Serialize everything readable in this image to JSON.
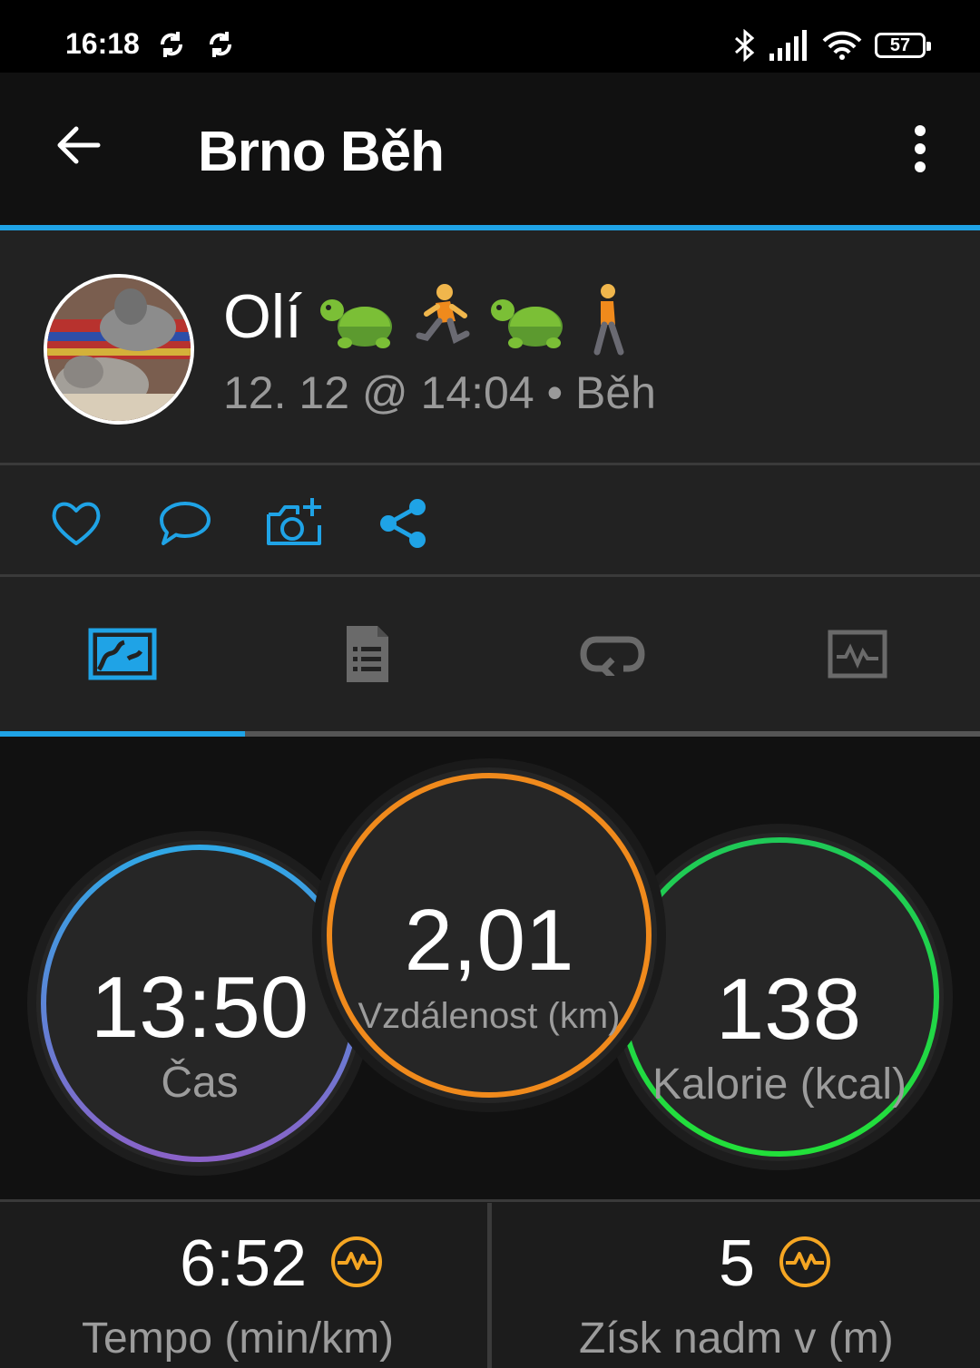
{
  "status_bar": {
    "time": "16:18",
    "battery": "57"
  },
  "header": {
    "title": "Brno Běh"
  },
  "profile": {
    "name": "Olí",
    "emoji_status": "🐢🏃🐢🚶",
    "meta": "12. 12 @ 14:04 • Běh"
  },
  "tabs": [
    {
      "icon": "map-icon",
      "active": true
    },
    {
      "icon": "document-list-icon",
      "active": false
    },
    {
      "icon": "loop-icon",
      "active": false
    },
    {
      "icon": "activity-chart-icon",
      "active": false
    }
  ],
  "stats": {
    "time": {
      "value": "13:50",
      "label": "Čas",
      "color_top": "#2fa8e6",
      "color_bottom": "#8a62c8"
    },
    "distance": {
      "value": "2,01",
      "label": "Vzdálenost (km)",
      "color": "#f08a1c"
    },
    "calories": {
      "value": "138",
      "label": "Kalorie (kcal)",
      "color_top": "#1fc957",
      "color_bottom": "#22d04a"
    }
  },
  "metrics": {
    "pace": {
      "value": "6:52",
      "label": "Tempo (min/km)"
    },
    "elevation": {
      "value": "5",
      "label": "Získ nadm v (m)"
    }
  },
  "colors": {
    "accent": "#1fa3e6",
    "metric_icon": "#f5a623"
  }
}
